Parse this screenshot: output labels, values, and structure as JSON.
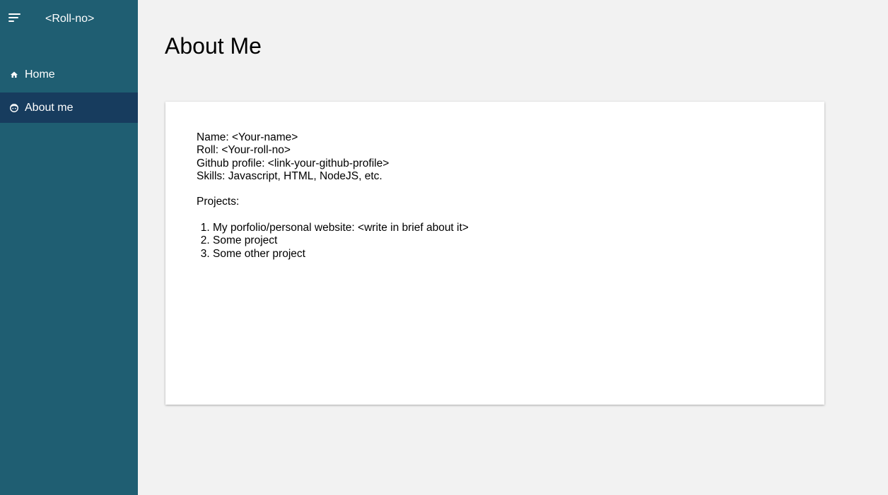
{
  "app": {
    "title": "<Roll-no>"
  },
  "sidebar": {
    "items": [
      {
        "label": "Home",
        "icon": "home-icon"
      },
      {
        "label": "About me",
        "icon": "face-icon"
      }
    ]
  },
  "main": {
    "title": "About Me",
    "card": {
      "name_line": "Name: <Your-name>",
      "roll_line": "Roll: <Your-roll-no>",
      "github_line": "Github profile: <link-your-github-profile>",
      "skills_line": "Skills: Javascript, HTML, NodeJS, etc.",
      "projects_heading": "Projects:",
      "projects": [
        "My porfolio/personal website: <write in brief about it>",
        "Some project",
        "Some other project"
      ]
    }
  },
  "colors": {
    "sidebar": "#1f5e72",
    "sidebar_active": "#173c5e",
    "background": "#f2f2f2",
    "card": "#ffffff"
  }
}
